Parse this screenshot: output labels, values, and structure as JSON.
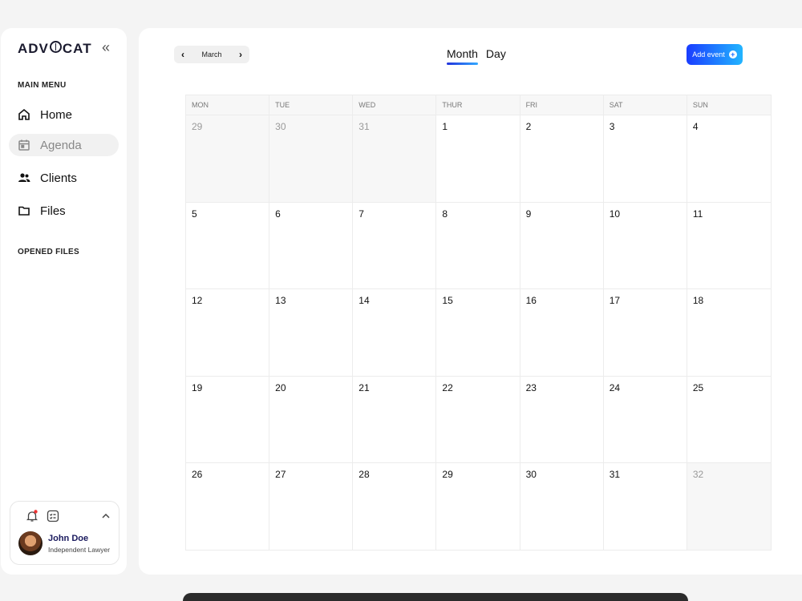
{
  "app": {
    "logo": "ADVOCAT"
  },
  "sidebar": {
    "main_menu_label": "MAIN MENU",
    "items": [
      {
        "label": "Home",
        "icon": "home-icon"
      },
      {
        "label": "Agenda",
        "icon": "calendar-icon",
        "active": true
      },
      {
        "label": "Clients",
        "icon": "users-icon"
      },
      {
        "label": "Files",
        "icon": "folder-icon"
      }
    ],
    "opened_files_label": "OPENED FILES",
    "user": {
      "name": "John Doe",
      "role": "Independent Lawyer"
    }
  },
  "header": {
    "month": "March",
    "views": [
      "Month",
      "Day"
    ],
    "active_view": "Month",
    "add_event_label": "Add event"
  },
  "calendar": {
    "weekdays": [
      "MON",
      "TUE",
      "WED",
      "THUR",
      "FRI",
      "SAT",
      "SUN"
    ],
    "days": [
      {
        "d": "29",
        "muted": true
      },
      {
        "d": "30",
        "muted": true
      },
      {
        "d": "31",
        "muted": true
      },
      {
        "d": "1"
      },
      {
        "d": "2"
      },
      {
        "d": "3"
      },
      {
        "d": "4"
      },
      {
        "d": "5"
      },
      {
        "d": "6"
      },
      {
        "d": "7"
      },
      {
        "d": "8"
      },
      {
        "d": "9"
      },
      {
        "d": "10"
      },
      {
        "d": "11"
      },
      {
        "d": "12"
      },
      {
        "d": "13"
      },
      {
        "d": "14"
      },
      {
        "d": "15"
      },
      {
        "d": "16"
      },
      {
        "d": "17"
      },
      {
        "d": "18"
      },
      {
        "d": "19"
      },
      {
        "d": "20"
      },
      {
        "d": "21"
      },
      {
        "d": "22"
      },
      {
        "d": "23"
      },
      {
        "d": "24"
      },
      {
        "d": "25"
      },
      {
        "d": "26"
      },
      {
        "d": "27"
      },
      {
        "d": "28"
      },
      {
        "d": "29"
      },
      {
        "d": "30"
      },
      {
        "d": "31"
      },
      {
        "d": "32",
        "muted": true
      }
    ]
  },
  "colors": {
    "accent_start": "#1a3dff",
    "accent_end": "#22b5ff",
    "user_name": "#1a1a5e"
  }
}
